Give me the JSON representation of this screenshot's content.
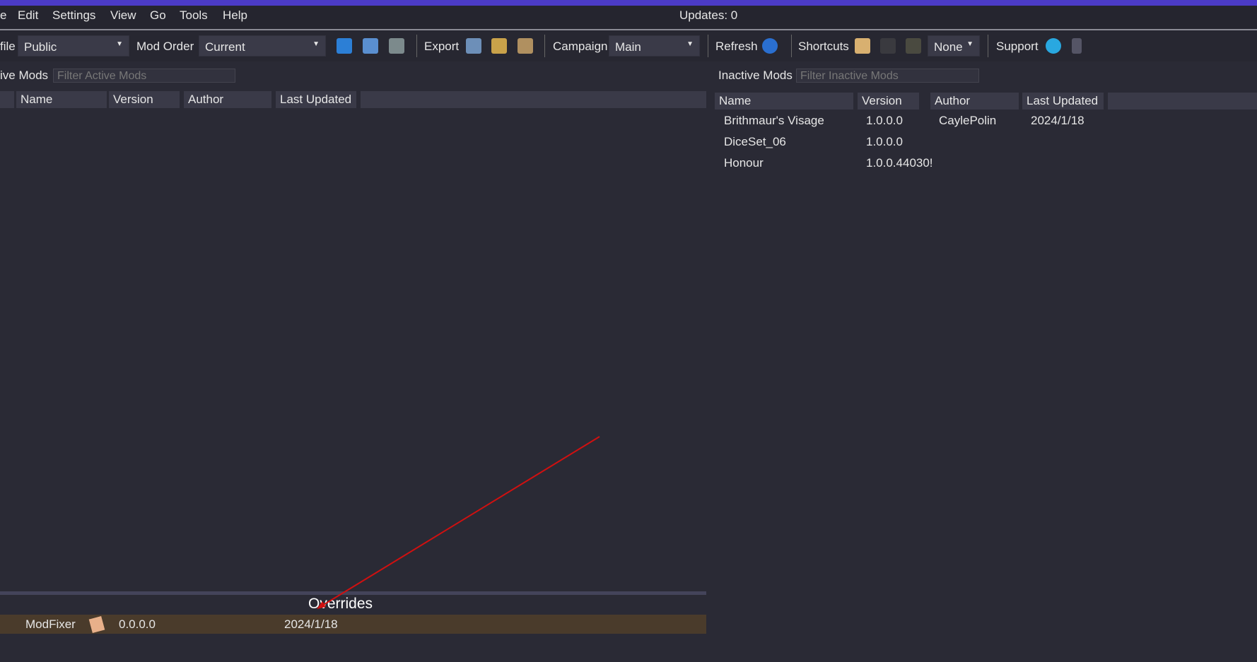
{
  "menu": {
    "items": [
      "e",
      "Edit",
      "Settings",
      "View",
      "Go",
      "Tools",
      "Help"
    ],
    "updates": "Updates:  0"
  },
  "toolbar": {
    "profile_label": "file",
    "profile_value": "Public",
    "mod_order_label": "Mod Order",
    "mod_order_value": "Current",
    "export_label": "Export",
    "campaign_label": "Campaign",
    "campaign_value": "Main",
    "refresh_label": "Refresh",
    "shortcuts_label": "Shortcuts",
    "shortcut_value": "None",
    "support_label": "Support"
  },
  "active": {
    "title": "ive Mods",
    "filter_placeholder": "Filter Active Mods",
    "columns": [
      "Name",
      "Version",
      "Author",
      "Last Updated"
    ]
  },
  "inactive": {
    "title": "Inactive Mods",
    "filter_placeholder": "Filter Inactive Mods",
    "columns": [
      "Name",
      "Version",
      "Author",
      "Last Updated"
    ],
    "rows": [
      {
        "name": "Brithmaur's Visage",
        "version": "1.0.0.0",
        "author": "CaylePolin",
        "updated": "2024/1/18"
      },
      {
        "name": "DiceSet_06",
        "version": "1.0.0.0",
        "author": "",
        "updated": ""
      },
      {
        "name": "Honour",
        "version": "1.0.0.44030!",
        "author": "",
        "updated": ""
      }
    ]
  },
  "overrides": {
    "title": "Overrides",
    "rows": [
      {
        "name": "ModFixer",
        "version": "0.0.0.0",
        "updated": "2024/1/18"
      }
    ]
  },
  "colors": {
    "accent_bar": "#4b3bc7",
    "override_row": "#4a3b2b",
    "annotation_arrow": "#d01010"
  }
}
